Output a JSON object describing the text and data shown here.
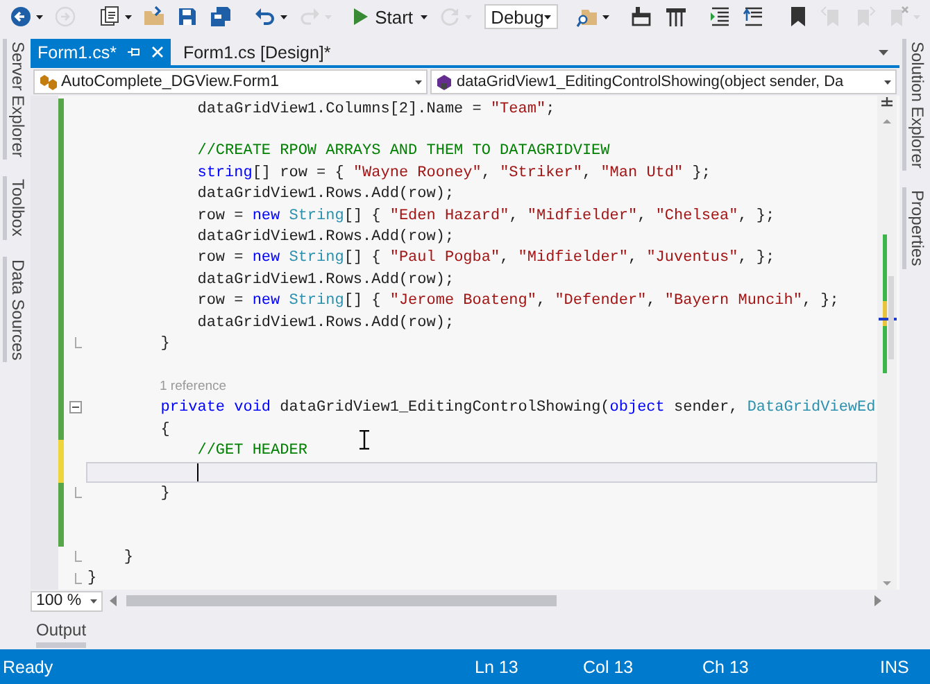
{
  "toolbar": {
    "items": [
      {
        "kind": "icon",
        "disabled": false,
        "dropdown": true
      },
      {
        "kind": "icon",
        "disabled": true,
        "dropdown": false
      },
      {
        "kind": "separator"
      },
      {
        "kind": "icon",
        "disabled": false,
        "dropdown": true
      },
      {
        "kind": "icon",
        "disabled": false,
        "dropdown": false
      },
      {
        "kind": "icon",
        "disabled": false,
        "dropdown": false
      },
      {
        "kind": "icon",
        "disabled": false,
        "dropdown": false
      },
      {
        "kind": "separator"
      },
      {
        "kind": "icon",
        "disabled": false,
        "dropdown": true
      },
      {
        "kind": "icon",
        "disabled": true,
        "dropdown": true
      },
      {
        "kind": "separator"
      },
      {
        "kind": "run",
        "label": "Start",
        "dropdown": true
      },
      {
        "kind": "icon",
        "disabled": true,
        "dropdown": true
      },
      {
        "kind": "combo",
        "value": "Debug"
      },
      {
        "kind": "separator"
      },
      {
        "kind": "icon",
        "disabled": false,
        "dropdown": true
      },
      {
        "kind": "separator"
      },
      {
        "kind": "icon",
        "disabled": false,
        "dropdown": false
      },
      {
        "kind": "icon",
        "disabled": false,
        "dropdown": false
      },
      {
        "kind": "separator"
      },
      {
        "kind": "icon",
        "disabled": false,
        "dropdown": false
      },
      {
        "kind": "icon",
        "disabled": false,
        "dropdown": false
      },
      {
        "kind": "separator"
      },
      {
        "kind": "icon",
        "disabled": false,
        "dropdown": false
      },
      {
        "kind": "icon",
        "disabled": true,
        "dropdown": false
      },
      {
        "kind": "icon",
        "disabled": true,
        "dropdown": false
      },
      {
        "kind": "icon",
        "disabled": true,
        "dropdown": true
      }
    ]
  },
  "left_tool_tabs": [
    {
      "label": "Server Explorer"
    },
    {
      "label": "Toolbox"
    },
    {
      "label": "Data Sources"
    }
  ],
  "right_tool_tabs": [
    {
      "label": "Solution Explorer"
    },
    {
      "label": "Properties"
    }
  ],
  "document_tabs": [
    {
      "label": "Form1.cs*",
      "selected": true
    },
    {
      "label": "Form1.cs [Design]*",
      "selected": false
    }
  ],
  "navigation_bar": {
    "type_combo": "AutoComplete_DGView.Form1",
    "member_combo": "dataGridView1_EditingControlShowing(object sender, Da"
  },
  "editor": {
    "zoom": "100 %",
    "lines": [
      {
        "kind": "code",
        "color": "#57a64a",
        "current": false,
        "tokens": [
          {
            "kind": "plain",
            "text": "            dataGridView1.Columns[2].Name = "
          },
          {
            "kind": "string",
            "text": "\"Team\""
          },
          {
            "kind": "plain",
            "text": ";"
          }
        ]
      },
      {
        "kind": "code",
        "color": "#57a64a",
        "current": false
      },
      {
        "kind": "code",
        "color": "#57a64a",
        "current": false,
        "tokens": [
          {
            "kind": "comment",
            "text": "            //CREATE RPOW ARRAYS AND THEM TO DATAGRIDVIEW"
          }
        ]
      },
      {
        "kind": "code",
        "color": "#57a64a",
        "current": false,
        "tokens": [
          {
            "kind": "keyword",
            "text": "            string"
          },
          {
            "kind": "plain",
            "text": "[] row = { "
          },
          {
            "kind": "string",
            "text": "\"Wayne Rooney\""
          },
          {
            "kind": "plain",
            "text": ", "
          },
          {
            "kind": "string",
            "text": "\"Striker\""
          },
          {
            "kind": "plain",
            "text": ", "
          },
          {
            "kind": "string",
            "text": "\"Man Utd\""
          },
          {
            "kind": "plain",
            "text": " };"
          }
        ]
      },
      {
        "kind": "code",
        "color": "#57a64a",
        "current": false,
        "tokens": [
          {
            "kind": "plain",
            "text": "            dataGridView1.Rows.Add(row);"
          }
        ]
      },
      {
        "kind": "code",
        "color": "#57a64a",
        "current": false,
        "tokens": [
          {
            "kind": "plain",
            "text": "            row = "
          },
          {
            "kind": "keyword",
            "text": "new "
          },
          {
            "kind": "type",
            "text": "String"
          },
          {
            "kind": "plain",
            "text": "[] { "
          },
          {
            "kind": "string",
            "text": "\"Eden Hazard\""
          },
          {
            "kind": "plain",
            "text": ", "
          },
          {
            "kind": "string",
            "text": "\"Midfielder\""
          },
          {
            "kind": "plain",
            "text": ", "
          },
          {
            "kind": "string",
            "text": "\"Chelsea\""
          },
          {
            "kind": "plain",
            "text": ", };"
          }
        ]
      },
      {
        "kind": "code",
        "color": "#57a64a",
        "current": false,
        "tokens": [
          {
            "kind": "plain",
            "text": "            dataGridView1.Rows.Add(row);"
          }
        ]
      },
      {
        "kind": "code",
        "color": "#57a64a",
        "current": false,
        "tokens": [
          {
            "kind": "plain",
            "text": "            row = "
          },
          {
            "kind": "keyword",
            "text": "new "
          },
          {
            "kind": "type",
            "text": "String"
          },
          {
            "kind": "plain",
            "text": "[] { "
          },
          {
            "kind": "string",
            "text": "\"Paul Pogba\""
          },
          {
            "kind": "plain",
            "text": ", "
          },
          {
            "kind": "string",
            "text": "\"Midfielder\""
          },
          {
            "kind": "plain",
            "text": ", "
          },
          {
            "kind": "string",
            "text": "\"Juventus\""
          },
          {
            "kind": "plain",
            "text": ", };"
          }
        ]
      },
      {
        "kind": "code",
        "color": "#57a64a",
        "current": false,
        "tokens": [
          {
            "kind": "plain",
            "text": "            dataGridView1.Rows.Add(row);"
          }
        ]
      },
      {
        "kind": "code",
        "color": "#57a64a",
        "current": false,
        "tokens": [
          {
            "kind": "plain",
            "text": "            row = "
          },
          {
            "kind": "keyword",
            "text": "new "
          },
          {
            "kind": "type",
            "text": "String"
          },
          {
            "kind": "plain",
            "text": "[] { "
          },
          {
            "kind": "string",
            "text": "\"Jerome Boateng\""
          },
          {
            "kind": "plain",
            "text": ", "
          },
          {
            "kind": "string",
            "text": "\"Defender\""
          },
          {
            "kind": "plain",
            "text": ", "
          },
          {
            "kind": "string",
            "text": "\"Bayern Muncih\""
          },
          {
            "kind": "plain",
            "text": ", };"
          }
        ]
      },
      {
        "kind": "code",
        "color": "#57a64a",
        "current": false,
        "tokens": [
          {
            "kind": "plain",
            "text": "            dataGridView1.Rows.Add(row);"
          }
        ]
      },
      {
        "kind": "code",
        "color": "#57a64a",
        "current": false,
        "region_end": true,
        "tokens": [
          {
            "kind": "plain",
            "text": "        }"
          }
        ]
      },
      {
        "kind": "code",
        "color": "#57a64a",
        "current": false
      },
      {
        "kind": "codelens",
        "color": "#57a64a",
        "current": false,
        "text": "1 reference"
      },
      {
        "kind": "code",
        "color": "#57a64a",
        "current": false,
        "expanded": true,
        "tokens": [
          {
            "kind": "keyword",
            "text": "        private void"
          },
          {
            "kind": "plain",
            "text": " dataGridView1_EditingControlShowing("
          },
          {
            "kind": "keyword",
            "text": "object"
          },
          {
            "kind": "plain",
            "text": " sender, "
          },
          {
            "kind": "type",
            "text": "DataGridViewEd"
          }
        ]
      },
      {
        "kind": "code",
        "color": "#57a64a",
        "current": false,
        "tokens": [
          {
            "kind": "plain",
            "text": "        {"
          }
        ]
      },
      {
        "kind": "code",
        "color": "#efd53c",
        "current": false,
        "tokens": [
          {
            "kind": "comment",
            "text": "            //GET HEADER"
          }
        ]
      },
      {
        "kind": "code",
        "color": "#efd53c",
        "current": true
      },
      {
        "kind": "code",
        "color": "#57a64a",
        "current": false,
        "region_end": true,
        "tokens": [
          {
            "kind": "plain",
            "text": "        }"
          }
        ]
      },
      {
        "kind": "code",
        "color": "#57a64a",
        "current": false
      },
      {
        "kind": "code",
        "color": "#57a64a",
        "current": false
      },
      {
        "kind": "code",
        "current": false,
        "region_end": true,
        "tokens": [
          {
            "kind": "plain",
            "text": "    }"
          }
        ]
      },
      {
        "kind": "code",
        "current": false,
        "region_end": true,
        "tokens": [
          {
            "kind": "plain",
            "text": "}"
          }
        ]
      }
    ]
  },
  "bottom_panel_tabs": [
    {
      "label": "Output"
    }
  ],
  "status_bar": {
    "items": [
      {
        "text": "Ready"
      },
      {
        "text": "Ln 13"
      },
      {
        "text": "Col 13"
      },
      {
        "text": "Ch 13"
      },
      {
        "text": "INS"
      }
    ]
  }
}
